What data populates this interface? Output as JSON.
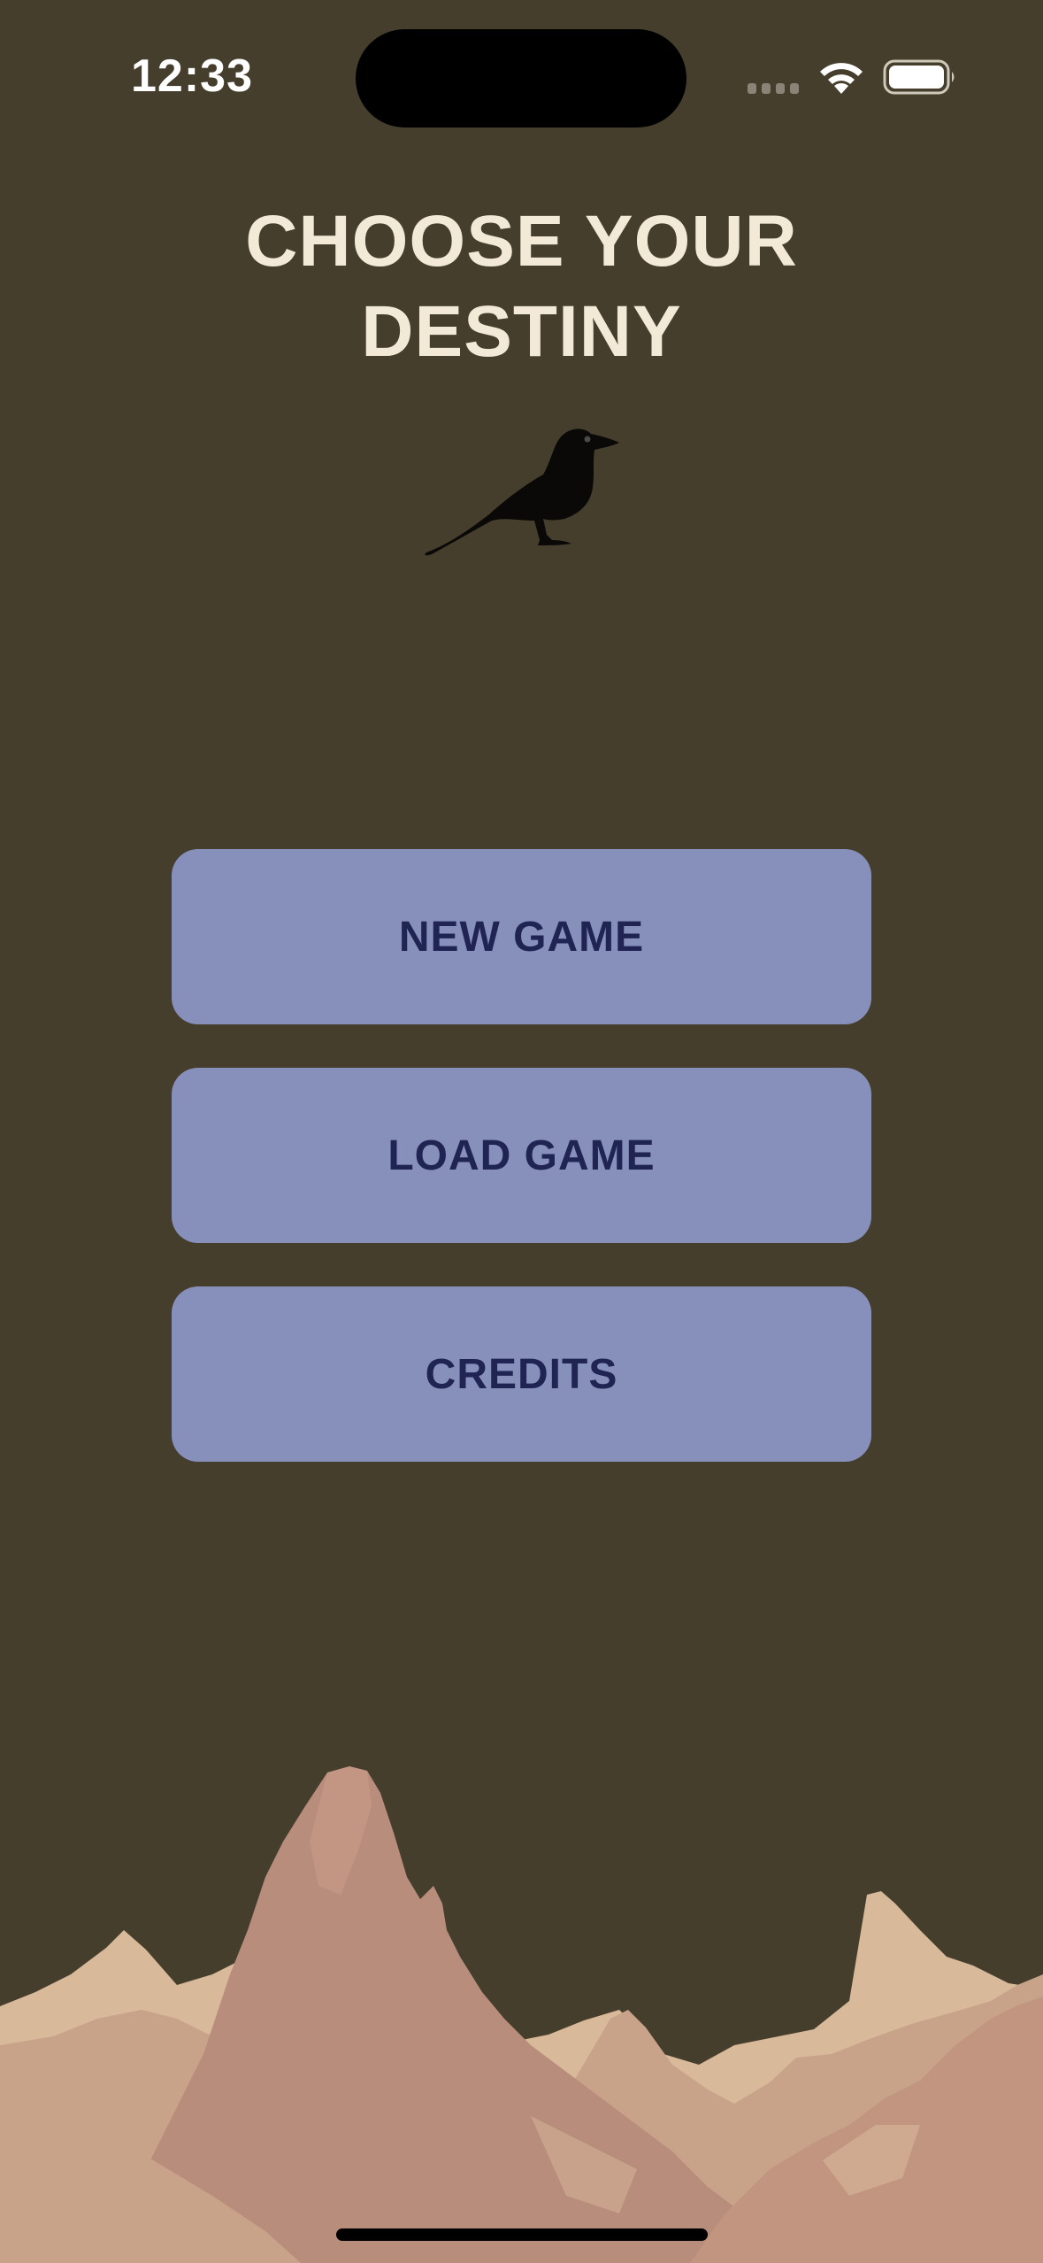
{
  "status_bar": {
    "time": "12:33"
  },
  "title": {
    "line1": "CHOOSE YOUR",
    "line2": "DESTINY"
  },
  "menu": {
    "new_game": "NEW GAME",
    "load_game": "LOAD GAME",
    "credits": "CREDITS"
  },
  "colors": {
    "background": "#453e2d",
    "title": "#f2e9d6",
    "button_fill": "#8790bb",
    "button_text": "#1f2453"
  },
  "icons": {
    "logo": "crow-icon",
    "scenery": "mountains-illustration"
  }
}
